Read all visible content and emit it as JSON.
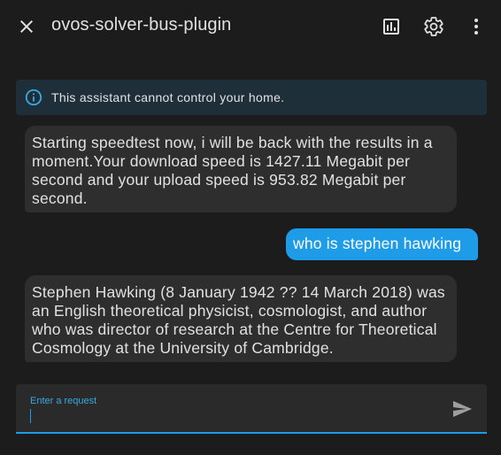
{
  "header": {
    "title": "ovos-solver-bus-plugin",
    "icons": [
      "close-icon",
      "chart-icon",
      "gear-icon",
      "more-vertical-icon"
    ]
  },
  "banner": {
    "text": "This assistant cannot control your home.",
    "icon": "info-icon"
  },
  "messages": [
    {
      "role": "assistant",
      "text": "Starting speedtest now, i will be back with the results in a moment.Your download speed is 1427.11 Megabit per second and your upload speed is 953.82 Megabit per second."
    },
    {
      "role": "user",
      "text": "who is stephen hawking"
    },
    {
      "role": "assistant",
      "text": "Stephen Hawking (8 January 1942 ?? 14 March 2018) was an English theoretical physicist, cosmologist, and author who was director of research at the Centre for Theoretical Cosmology at the University of Cambridge."
    }
  ],
  "input": {
    "label": "Enter a request",
    "value": ""
  },
  "colors": {
    "background": "#1c1c1c",
    "accent": "#1e9ce8",
    "assistant_bubble": "#2e2e2e",
    "banner": "#1f2f3a"
  }
}
